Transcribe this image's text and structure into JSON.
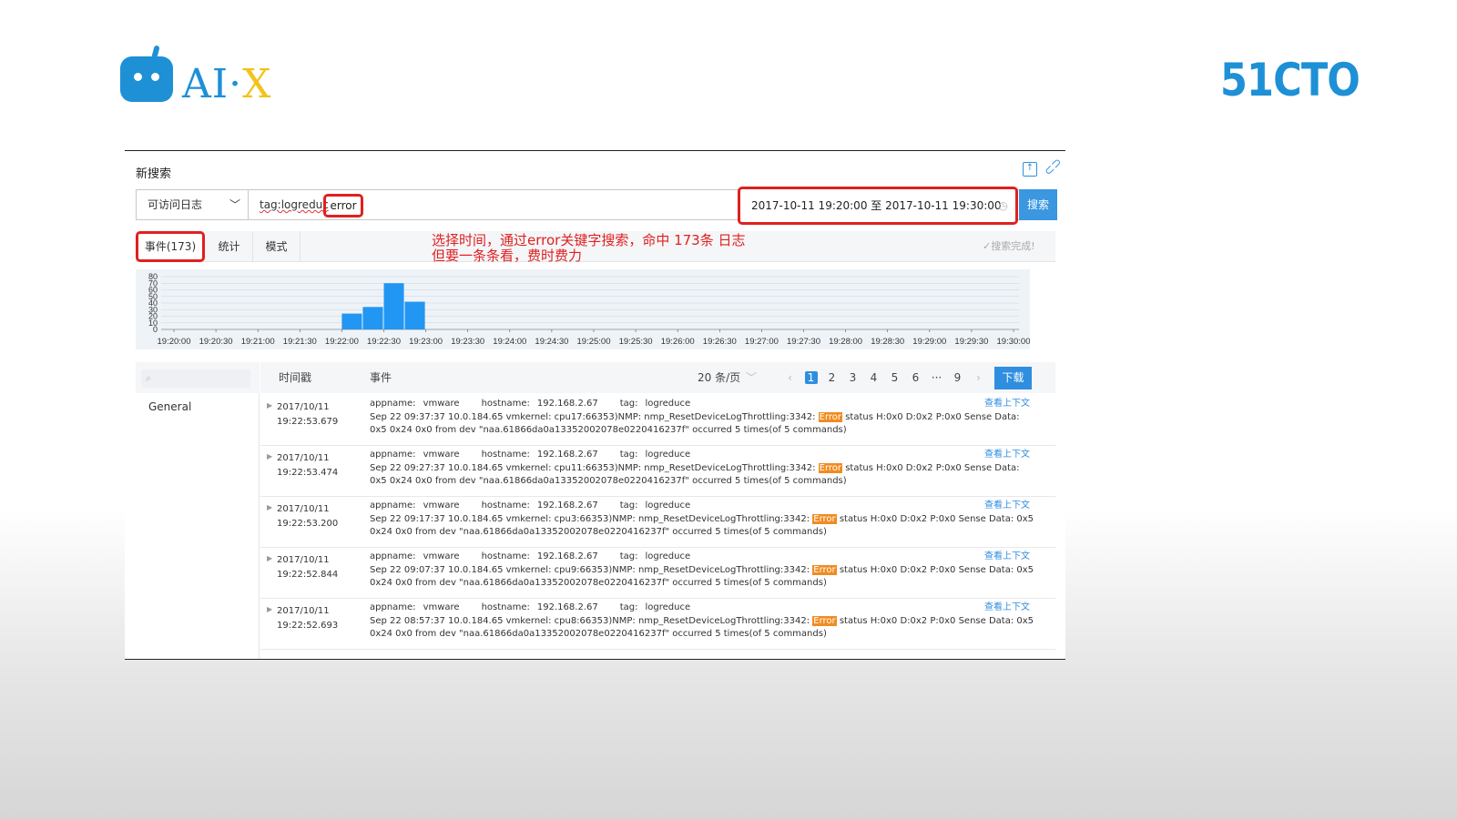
{
  "brand": {
    "logo_text_main": "AI·",
    "logo_text_x": "X",
    "right_brand": "51CTO"
  },
  "panel": {
    "title": "新搜索",
    "save_icon": "save-icon",
    "link_icon": "link-icon"
  },
  "search": {
    "source": "可访问日志",
    "query_prefix": "tag:logreduc",
    "query_keyword": "error",
    "time_range": "2017-10-11 19:20:00 至 2017-10-11 19:30:00",
    "button_label": "搜索"
  },
  "tabs": [
    {
      "label": "事件(173)"
    },
    {
      "label": "统计"
    },
    {
      "label": "模式"
    }
  ],
  "annotation": {
    "line1": "选择时间，通过error关键字搜索，命中 173条 日志",
    "line2": "但要一条条看，费时费力"
  },
  "search_status": "✓搜索完成!",
  "chart_data": {
    "type": "bar",
    "x": [
      "19:20:00",
      "19:20:30",
      "19:21:00",
      "19:21:30",
      "19:22:00",
      "19:22:30",
      "19:23:00",
      "19:23:30",
      "19:24:00",
      "19:24:30",
      "19:25:00",
      "19:25:30",
      "19:26:00",
      "19:26:30",
      "19:27:00",
      "19:27:30",
      "19:28:00",
      "19:28:30",
      "19:29:00",
      "19:29:30",
      "19:30:00"
    ],
    "bars": [
      {
        "label": "19:22:00",
        "value": 24
      },
      {
        "label": "19:22:15",
        "value": 34
      },
      {
        "label": "19:22:30",
        "value": 70
      },
      {
        "label": "19:22:45",
        "value": 42
      }
    ],
    "y_ticks": [
      "80",
      "70",
      "60",
      "50",
      "40",
      "30",
      "20",
      "10",
      "0"
    ],
    "ylim": [
      0,
      80
    ],
    "color": "#2196f3",
    "grid": true
  },
  "events": {
    "sidebar_general": "General",
    "header_timestamp": "时间戳",
    "header_event": "事件",
    "per_page": "20 条/页",
    "pages": [
      "1",
      "2",
      "3",
      "4",
      "5",
      "6",
      "···",
      "9"
    ],
    "download": "下载",
    "rows": [
      {
        "date": "2017/10/11",
        "time": "19:22:53.679",
        "appname_label": "appname:",
        "appname": "vmware",
        "hostname_label": "hostname:",
        "hostname": "192.168.2.67",
        "tag_label": "tag:",
        "tag": "logreduce",
        "msg_pre": "Sep 22 09:37:37 10.0.184.65 vmkernel: cpu17:66353)NMP: nmp_ResetDeviceLogThrottling:3342: ",
        "msg_err": "Error",
        "msg_post": " status H:0x0 D:0x2 P:0x0 Sense Data: 0x5 0x24 0x0 from dev \"naa.61866da0a13352002078e0220416237f\" occurred 5 times(of 5 commands)",
        "context": "查看上下文"
      },
      {
        "date": "2017/10/11",
        "time": "19:22:53.474",
        "appname_label": "appname:",
        "appname": "vmware",
        "hostname_label": "hostname:",
        "hostname": "192.168.2.67",
        "tag_label": "tag:",
        "tag": "logreduce",
        "msg_pre": "Sep 22 09:27:37 10.0.184.65 vmkernel: cpu11:66353)NMP: nmp_ResetDeviceLogThrottling:3342: ",
        "msg_err": "Error",
        "msg_post": " status H:0x0 D:0x2 P:0x0 Sense Data: 0x5 0x24 0x0 from dev \"naa.61866da0a13352002078e0220416237f\" occurred 5 times(of 5 commands)",
        "context": "查看上下文"
      },
      {
        "date": "2017/10/11",
        "time": "19:22:53.200",
        "appname_label": "appname:",
        "appname": "vmware",
        "hostname_label": "hostname:",
        "hostname": "192.168.2.67",
        "tag_label": "tag:",
        "tag": "logreduce",
        "msg_pre": "Sep 22 09:17:37 10.0.184.65 vmkernel: cpu3:66353)NMP: nmp_ResetDeviceLogThrottling:3342: ",
        "msg_err": "Error",
        "msg_post": " status H:0x0 D:0x2 P:0x0 Sense Data: 0x5 0x24 0x0 from dev \"naa.61866da0a13352002078e0220416237f\" occurred 5 times(of 5 commands)",
        "context": "查看上下文"
      },
      {
        "date": "2017/10/11",
        "time": "19:22:52.844",
        "appname_label": "appname:",
        "appname": "vmware",
        "hostname_label": "hostname:",
        "hostname": "192.168.2.67",
        "tag_label": "tag:",
        "tag": "logreduce",
        "msg_pre": "Sep 22 09:07:37 10.0.184.65 vmkernel: cpu9:66353)NMP: nmp_ResetDeviceLogThrottling:3342: ",
        "msg_err": "Error",
        "msg_post": " status H:0x0 D:0x2 P:0x0 Sense Data: 0x5 0x24 0x0 from dev \"naa.61866da0a13352002078e0220416237f\" occurred 5 times(of 5 commands)",
        "context": "查看上下文"
      },
      {
        "date": "2017/10/11",
        "time": "19:22:52.693",
        "appname_label": "appname:",
        "appname": "vmware",
        "hostname_label": "hostname:",
        "hostname": "192.168.2.67",
        "tag_label": "tag:",
        "tag": "logreduce",
        "msg_pre": "Sep 22 08:57:37 10.0.184.65 vmkernel: cpu8:66353)NMP: nmp_ResetDeviceLogThrottling:3342: ",
        "msg_err": "Error",
        "msg_post": " status H:0x0 D:0x2 P:0x0 Sense Data: 0x5 0x24 0x0 from dev \"naa.61866da0a13352002078e0220416237f\" occurred 5 times(of 5 commands)",
        "context": "查看上下文"
      }
    ]
  }
}
